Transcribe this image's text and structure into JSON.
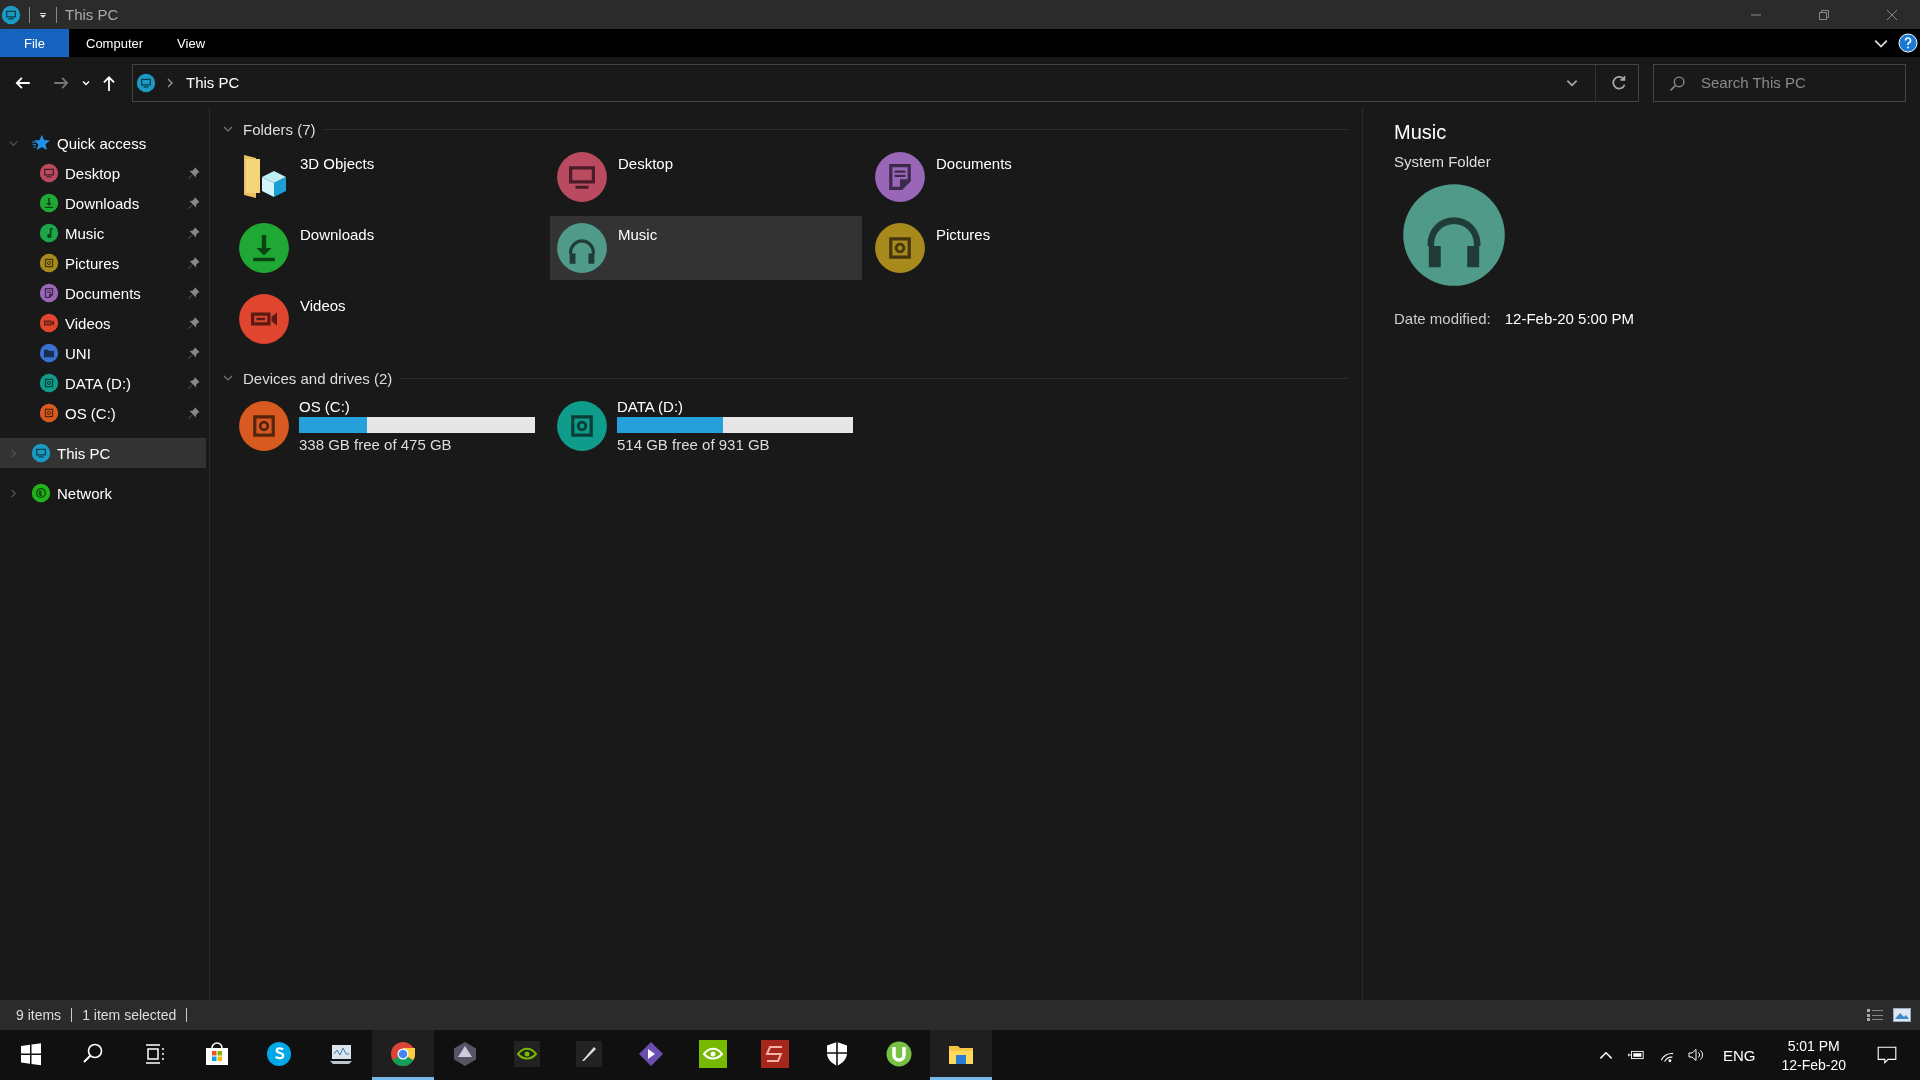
{
  "window": {
    "title": "This PC"
  },
  "ribbon": {
    "tabs": [
      {
        "label": "File",
        "selected": true
      },
      {
        "label": "Computer",
        "selected": false
      },
      {
        "label": "View",
        "selected": false
      }
    ]
  },
  "nav": {
    "buttons": [
      {
        "kind": "back",
        "disabled": false
      },
      {
        "kind": "forward",
        "disabled": true
      },
      {
        "kind": "recent",
        "disabled": false
      },
      {
        "kind": "up",
        "disabled": false
      }
    ],
    "path": "This PC",
    "search": {
      "placeholder": "Search This PC"
    }
  },
  "sidebar": {
    "sections": [
      {
        "label": "Quick access",
        "kind": "star",
        "color": "#1e90e8",
        "expanded": true,
        "selected": false,
        "children": [
          {
            "label": "Desktop",
            "kind": "desktop",
            "color": "#b94a5f",
            "pinned": true
          },
          {
            "label": "Downloads",
            "kind": "download",
            "color": "#1fa834",
            "pinned": true
          },
          {
            "label": "Music",
            "kind": "note",
            "color": "#1ca64a",
            "pinned": true
          },
          {
            "label": "Pictures",
            "kind": "picture",
            "color": "#a88a1c",
            "pinned": true
          },
          {
            "label": "Documents",
            "kind": "document",
            "color": "#9a66b8",
            "pinned": true
          },
          {
            "label": "Videos",
            "kind": "video",
            "color": "#e0452f",
            "pinned": true
          },
          {
            "label": "UNI",
            "kind": "folder",
            "color": "#3a70d2",
            "pinned": true
          },
          {
            "label": "DATA (D:)",
            "kind": "drive",
            "color": "#0f9c8a",
            "pinned": true
          },
          {
            "label": "OS (C:)",
            "kind": "drive",
            "color": "#d85a20",
            "pinned": true
          }
        ]
      },
      {
        "label": "This PC",
        "kind": "desktop",
        "color": "#1a9bc6",
        "expanded": false,
        "selected": true
      },
      {
        "label": "Network",
        "kind": "globe",
        "color": "#22b21a",
        "expanded": false,
        "selected": false
      }
    ]
  },
  "groups": [
    {
      "title": "Folders (7)",
      "kind": "folders",
      "expanded": true,
      "items": [
        {
          "label": "3D Objects",
          "kind": "cube",
          "selected": false
        },
        {
          "label": "Desktop",
          "kind": "desktop",
          "color": "#b94a5f",
          "selected": false
        },
        {
          "label": "Documents",
          "kind": "document",
          "color": "#9a66b8",
          "selected": false
        },
        {
          "label": "Downloads",
          "kind": "download",
          "color": "#1fa834",
          "selected": false
        },
        {
          "label": "Music",
          "kind": "headphones",
          "color": "#4f9a88",
          "selected": true
        },
        {
          "label": "Pictures",
          "kind": "picture",
          "color": "#a88a1c",
          "selected": false
        },
        {
          "label": "Videos",
          "kind": "video",
          "color": "#e0452f",
          "selected": false
        }
      ]
    },
    {
      "title": "Devices and drives (2)",
      "kind": "drives",
      "expanded": true,
      "items": [
        {
          "label": "OS (C:)",
          "kind": "drive",
          "color": "#d85a20",
          "level": 0.29,
          "reading": "338 GB free of 475 GB"
        },
        {
          "label": "DATA (D:)",
          "kind": "drive",
          "color": "#0f9c8a",
          "level": 0.45,
          "reading": "514 GB free of 931 GB"
        }
      ]
    }
  ],
  "details": {
    "title": "Music",
    "subtitle": "System Folder",
    "kind": "headphones",
    "color": "#4f9a88",
    "fields": [
      {
        "label": "Date modified:",
        "value": "12-Feb-20 5:00 PM"
      }
    ]
  },
  "status_bar": {
    "count": "9 items",
    "selection": "1 item selected"
  },
  "taskbar": {
    "apps": [
      {
        "kind": "start",
        "active": false
      },
      {
        "kind": "search",
        "active": false
      },
      {
        "kind": "taskview",
        "active": false
      },
      {
        "kind": "store",
        "active": false
      },
      {
        "kind": "skype",
        "active": false
      },
      {
        "kind": "monitor",
        "active": false
      },
      {
        "kind": "chrome",
        "active": true
      },
      {
        "kind": "hexagon",
        "active": false
      },
      {
        "kind": "nvidia-dark",
        "active": false
      },
      {
        "kind": "pen",
        "active": false
      },
      {
        "kind": "diamond",
        "active": false
      },
      {
        "kind": "nvidia",
        "active": false
      },
      {
        "kind": "s-logo",
        "active": false
      },
      {
        "kind": "shield",
        "active": false
      },
      {
        "kind": "torrent",
        "active": false
      },
      {
        "kind": "explorer",
        "active": true
      }
    ],
    "language": "ENG",
    "time": "5:01 PM",
    "date": "12-Feb-20"
  }
}
